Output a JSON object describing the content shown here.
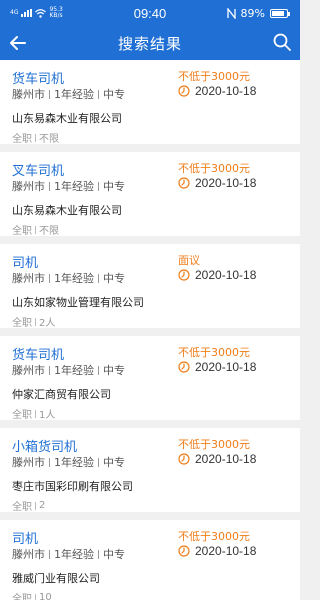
{
  "status": {
    "network": "4G",
    "speed": "95.3",
    "speed_unit": "KB/s",
    "time": "09:40",
    "battery": "89%",
    "battery_level": 0.89
  },
  "header": {
    "title": "搜索结果"
  },
  "jobs": [
    {
      "title": "货车司机",
      "salary": "不低于3000元",
      "city": "滕州市",
      "experience": "1年经验",
      "education": "中专",
      "date": "2020-10-18",
      "company": "山东易森木业有限公司",
      "type": "全职",
      "headcount": "不限"
    },
    {
      "title": "叉车司机",
      "salary": "不低于3000元",
      "city": "滕州市",
      "experience": "1年经验",
      "education": "中专",
      "date": "2020-10-18",
      "company": "山东易森木业有限公司",
      "type": "全职",
      "headcount": "不限"
    },
    {
      "title": "司机",
      "salary": "面议",
      "city": "滕州市",
      "experience": "1年经验",
      "education": "中专",
      "date": "2020-10-18",
      "company": "山东如家物业管理有限公司",
      "type": "全职",
      "headcount": "2人"
    },
    {
      "title": "货车司机",
      "salary": "不低于3000元",
      "city": "滕州市",
      "experience": "1年经验",
      "education": "中专",
      "date": "2020-10-18",
      "company": "仲家汇商贸有限公司",
      "type": "全职",
      "headcount": "1人"
    },
    {
      "title": "小箱货司机",
      "salary": "不低于3000元",
      "city": "滕州市",
      "experience": "1年经验",
      "education": "中专",
      "date": "2020-10-18",
      "company": "枣庄市国彩印刷有限公司",
      "type": "全职",
      "headcount": "2"
    },
    {
      "title": "司机",
      "salary": "不低于3000元",
      "city": "滕州市",
      "experience": "1年经验",
      "education": "中专",
      "date": "2020-10-18",
      "company": "雅威门业有限公司",
      "type": "全职",
      "headcount": "10"
    }
  ],
  "icons": {
    "back": "back-arrow-icon",
    "search": "search-icon",
    "clock": "clock-icon"
  },
  "colors": {
    "primary": "#1f6fd4",
    "salary": "#f07d1a",
    "background": "#f0f0f0"
  }
}
